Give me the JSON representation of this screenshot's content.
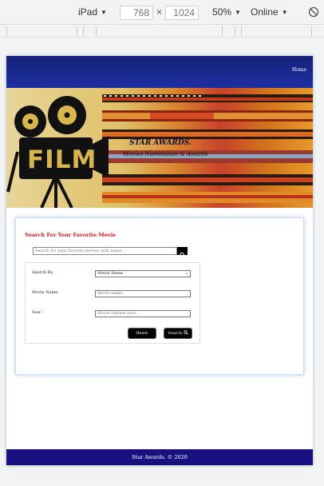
{
  "devtools": {
    "device": "iPad",
    "width": "768",
    "height": "1024",
    "zoom": "50%",
    "network": "Online"
  },
  "site": {
    "nav": {
      "home_label": "Home"
    },
    "hero": {
      "title": "STAR AWARDS.",
      "subtitle": "Movies Nomination & Awards",
      "image_text": "FILM"
    },
    "search_panel": {
      "heading": "Search For Your Favorite Movie",
      "quick_search_placeholder": "Search for your favorite movies with name...",
      "search_by_label": "Search By:",
      "search_by_value": "Movie Name",
      "movie_name_label": "Movie Name:",
      "movie_name_placeholder": "Movie name..",
      "year_label": "Year:",
      "year_placeholder": "Movie release year..",
      "reset_label": "Reset",
      "search_label": "Search"
    },
    "footer": {
      "text": "Star Awards. © 2020"
    }
  },
  "colors": {
    "navbar": "#1c2fa0",
    "heading_red": "#e0151b",
    "footer": "#1a1180",
    "button_black": "#000000"
  }
}
